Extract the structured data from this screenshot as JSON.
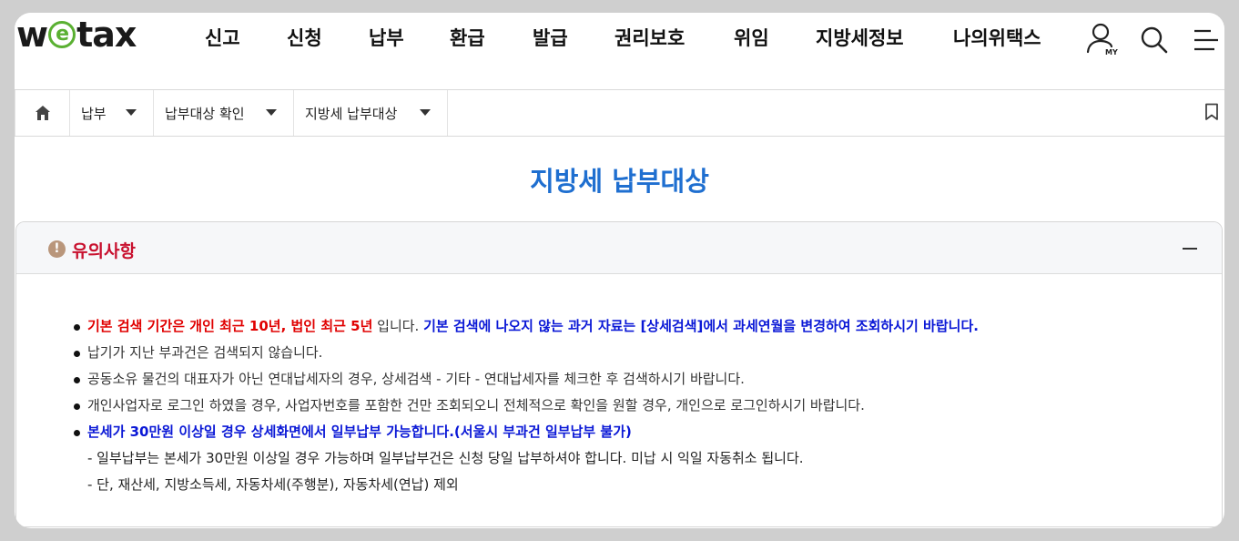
{
  "logo": {
    "pre": "w",
    "mid": "e",
    "post": "tax"
  },
  "gnb": [
    {
      "label": "신고"
    },
    {
      "label": "신청"
    },
    {
      "label": "납부"
    },
    {
      "label": "환급"
    },
    {
      "label": "발급"
    },
    {
      "label": "권리보호"
    },
    {
      "label": "위임"
    },
    {
      "label": "지방세정보"
    },
    {
      "label": "나의위택스"
    }
  ],
  "util": {
    "my_label": "MY"
  },
  "breadcrumb": [
    {
      "label": "납부"
    },
    {
      "label": "납부대상 확인"
    },
    {
      "label": "지방세 납부대상"
    }
  ],
  "page": {
    "title": "지방세 납부대상"
  },
  "notice": {
    "icon_glyph": "!",
    "title": "유의사항",
    "items": [
      {
        "red": "기본 검색 기간은 개인 최근 10년, 법인 최근 5년",
        "normal": " 입니다. ",
        "blue": "기본 검색에 나오지 않는 과거 자료는 [상세검색]에서 과세연월을 변경하여 조회하시기 바랍니다."
      },
      {
        "normal": "납기가 지난 부과건은 검색되지 않습니다."
      },
      {
        "normal": "공동소유 물건의 대표자가 아닌 연대납세자의 경우, 상세검색 - 기타 - 연대납세자를 체크한 후 검색하시기 바랍니다."
      },
      {
        "normal": "개인사업자로 로그인 하였을 경우, 사업자번호를 포함한 건만 조회되오니 전체적으로 확인을 원할 경우, 개인으로 로그인하시기 바랍니다."
      },
      {
        "blue": "본세가 30만원 이상일 경우 상세화면에서 일부납부 가능합니다.(서울시 부과건 일부납부 불가)"
      }
    ],
    "sub_lines": [
      "- 일부납부는 본세가 30만원 이상일 경우 가능하며 일부납부건은 신청 당일 납부하셔야 합니다. 미납 시 익일 자동취소 됩니다.",
      "- 단, 재산세, 지방소득세, 자동차세(주행분), 자동차세(연납) 제외"
    ]
  },
  "colors": {
    "title_blue": "#1f6fd0",
    "alert_red": "#c8102e",
    "brand_green": "#5ab032"
  },
  "icons": [
    "person-my-icon",
    "search-icon",
    "menu-icon",
    "home-icon",
    "chevron-down-icon",
    "bookmark-icon",
    "alert-icon",
    "collapse-icon"
  ]
}
